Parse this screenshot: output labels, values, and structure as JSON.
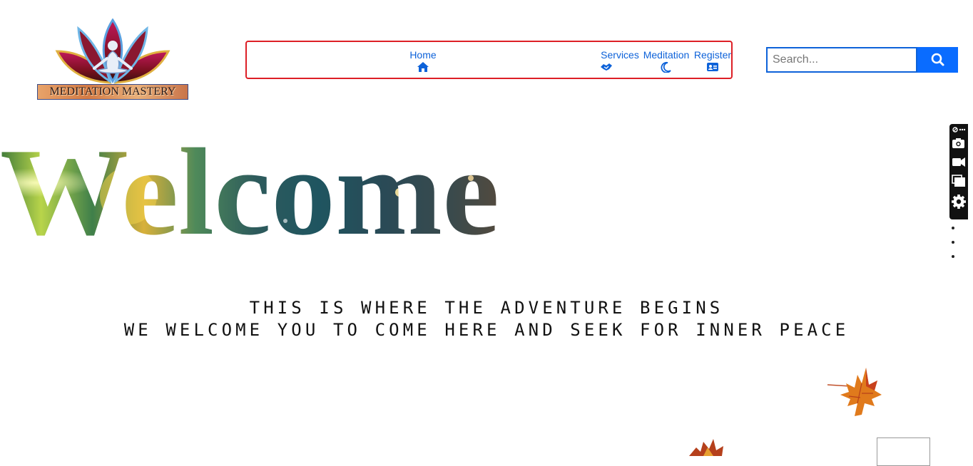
{
  "logo": {
    "text": "MEDITATION MASTERY"
  },
  "nav": {
    "items": [
      {
        "label": "Home",
        "icon": "home-icon"
      },
      {
        "label": "Services",
        "icon": "handshake-icon"
      },
      {
        "label": "Meditation",
        "icon": "moon-icon"
      },
      {
        "label": "Register",
        "icon": "id-card-icon"
      }
    ]
  },
  "search": {
    "placeholder": "Search...",
    "icon": "search-icon"
  },
  "hero": {
    "title": "Welcome",
    "line1": "THIS IS WHERE THE ADVENTURE BEGINS",
    "line2": "WE WELCOME YOU TO COME HERE AND SEEK FOR INNER PEACE"
  },
  "toolbar": {
    "icons": [
      "extension-icon",
      "more-icon",
      "camera-icon",
      "video-icon",
      "copy-icon",
      "gear-icon"
    ]
  },
  "colors": {
    "nav_border": "#dd1f26",
    "link": "#0d62d9",
    "search_button": "#0a6cff",
    "text": "#111111"
  }
}
